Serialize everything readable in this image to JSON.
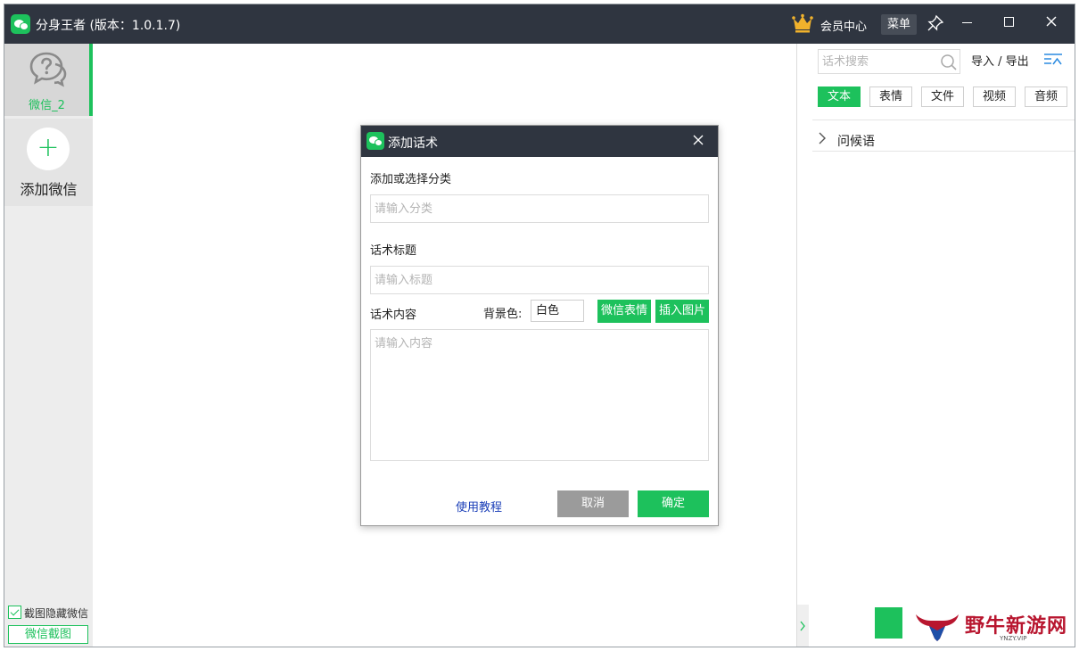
{
  "app": {
    "title": "分身王者 (版本：1.0.1.7)",
    "vip_label": "会员中心",
    "menu_label": "菜单",
    "accent_color": "#1dc15c",
    "titlebar_color": "#2f3540"
  },
  "sidebar": {
    "account_name": "微信_2",
    "add_label": "添加微信",
    "hide_checkbox_label": "截图隐藏微信",
    "hide_checkbox_checked": true,
    "screenshot_button": "微信截图"
  },
  "right_panel": {
    "search_placeholder": "话术搜索",
    "import_export": "导入 / 导出",
    "tabs": [
      {
        "label": "文本",
        "active": true
      },
      {
        "label": "表情",
        "active": false
      },
      {
        "label": "文件",
        "active": false
      },
      {
        "label": "视频",
        "active": false
      },
      {
        "label": "音频",
        "active": false
      }
    ],
    "groups": [
      {
        "label": "问候语"
      }
    ]
  },
  "dialog": {
    "title": "添加话术",
    "category_label": "添加或选择分类",
    "category_placeholder": "请输入分类",
    "title_label": "话术标题",
    "title_placeholder": "请输入标题",
    "content_label": "话术内容",
    "bg_color_label": "背景色:",
    "bg_color_value": "白色",
    "wechat_emoji_button": "微信表情",
    "insert_image_button": "插入图片",
    "content_placeholder": "请输入内容",
    "tutorial_link": "使用教程",
    "cancel_button": "取消",
    "ok_button": "确定"
  },
  "watermark": {
    "text": "野牛新游网",
    "sub": "YNZY.VIP"
  }
}
